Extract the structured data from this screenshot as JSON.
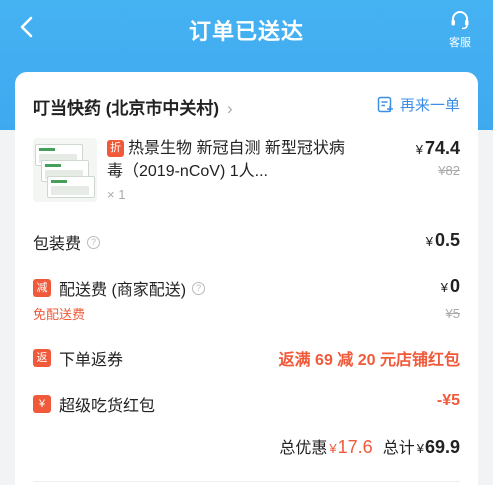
{
  "header": {
    "title": "订单已送达",
    "customer_service_label": "客服"
  },
  "shop": {
    "name": "叮当快药 (北京市中关村)",
    "chevron": "›",
    "reorder_label": "再来一单"
  },
  "product": {
    "tag": "折",
    "name": "热景生物 新冠自测 新型冠状病毒（2019-nCoV) 1人...",
    "quantity": "× 1",
    "price_yen": "¥",
    "price": "74.4",
    "original_price": "¥82"
  },
  "fees": {
    "packaging": {
      "label": "包装费",
      "help": "?",
      "yen": "¥",
      "value": "0.5"
    },
    "delivery": {
      "tag": "减",
      "label": "配送费 (商家配送)",
      "help": "?",
      "yen": "¥",
      "value": "0",
      "note": "免配送费",
      "original": "¥5"
    },
    "rebate": {
      "tag": "返",
      "label": "下单返券",
      "value": "返满 69 减 20 元店铺红包"
    },
    "red_packet": {
      "tag": "¥",
      "label": "超级吃货红包",
      "value": "-¥5"
    }
  },
  "summary": {
    "discount_label": "总优惠",
    "discount_yen": "¥",
    "discount_value": "17.6",
    "total_label": "总计",
    "total_yen": "¥",
    "total_value": "69.9"
  },
  "colors": {
    "header_blue": "#45b2f2",
    "accent_red": "#f05a3a",
    "link_blue": "#3d8fe6"
  }
}
